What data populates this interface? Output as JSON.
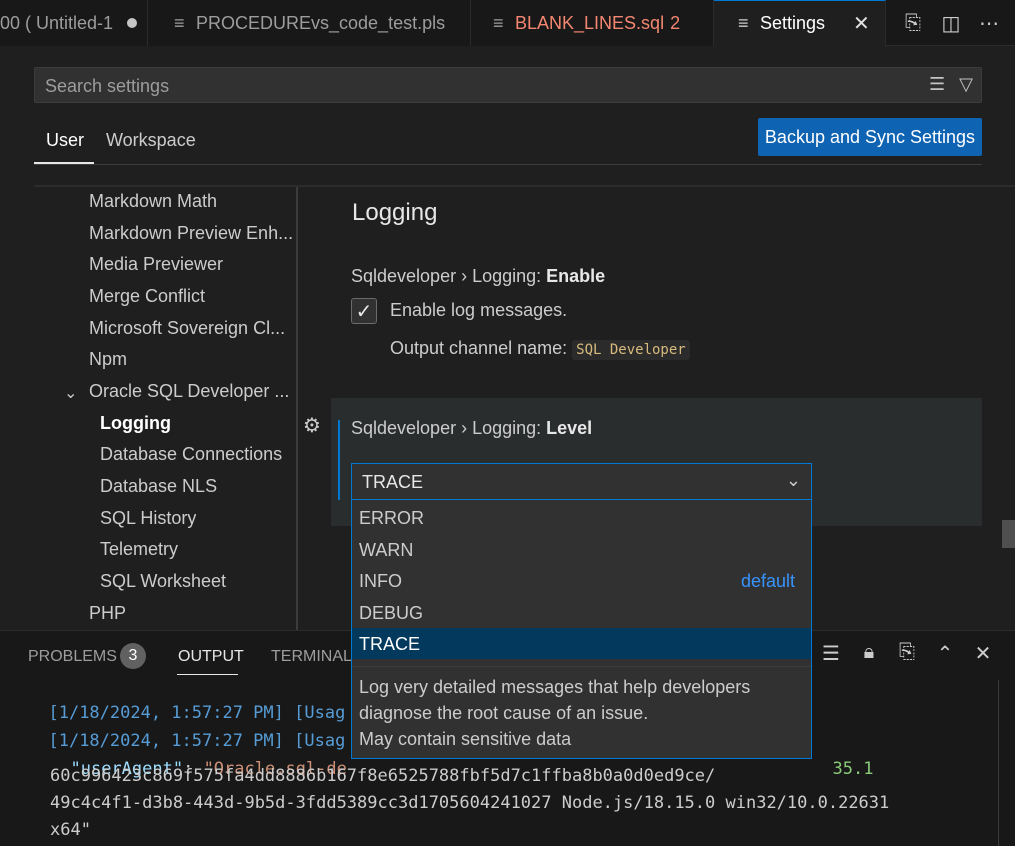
{
  "tabs": [
    {
      "label": "00 ( Untitled-1",
      "state": "modified"
    },
    {
      "label": "PROCEDUREvs_code_test.pls"
    },
    {
      "label": "BLANK_LINES.sql",
      "problems": "2"
    },
    {
      "label": "Settings",
      "active": true
    }
  ],
  "search": {
    "placeholder": "Search settings"
  },
  "scope_tabs": {
    "user": "User",
    "workspace": "Workspace"
  },
  "sync_button": "Backup and Sync Settings",
  "toc": {
    "items": [
      "Markdown Math",
      "Markdown Preview Enh...",
      "Media Previewer",
      "Merge Conflict",
      "Microsoft Sovereign Cl...",
      "Npm",
      "Oracle SQL Developer ...",
      "Logging",
      "Database Connections",
      "Database NLS",
      "SQL History",
      "Telemetry",
      "SQL Worksheet",
      "PHP"
    ]
  },
  "section_title": "Logging",
  "setting_enable": {
    "prefix": "Sqldeveloper › Logging: ",
    "name": "Enable",
    "checkbox_label": "Enable log messages.",
    "channel_label": "Output channel name:",
    "channel_value": "SQL Developer"
  },
  "setting_level": {
    "prefix": "Sqldeveloper › Logging: ",
    "name": "Level",
    "selected": "TRACE",
    "options": [
      "ERROR",
      "WARN",
      "INFO",
      "DEBUG",
      "TRACE"
    ],
    "default_option": "INFO",
    "default_label": "default",
    "option_description": [
      "Log very detailed messages that help developers",
      "diagnose the root cause of an issue.",
      "May contain sensitive data"
    ]
  },
  "panel": {
    "tabs": {
      "problems": "PROBLEMS",
      "output": "OUTPUT",
      "terminal": "TERMINAL"
    },
    "problems_count": "3",
    "output_lines": [
      {
        "ts": "[1/18/2024, 1:57:27 PM]",
        "rest": "[Usag"
      },
      {
        "ts": "[1/18/2024, 1:57:27 PM]",
        "rest": "[Usag"
      }
    ],
    "user_agent_key": "\"userAgent\"",
    "user_agent_start": "\"Oracle.sql-de",
    "user_agent_tail": "35.1",
    "ua_line2": "60c996423c869f575fa4dd8886b167f8e6525788fbf5d7c1ffba8b0a0d0ed9ce/",
    "ua_line3": "49c4c4f1-d3b8-443d-9b5d-3fdd5389cc3d1705604241027 Node.js/18.15.0 win32/10.0.22631",
    "ua_line4": "x64\""
  }
}
